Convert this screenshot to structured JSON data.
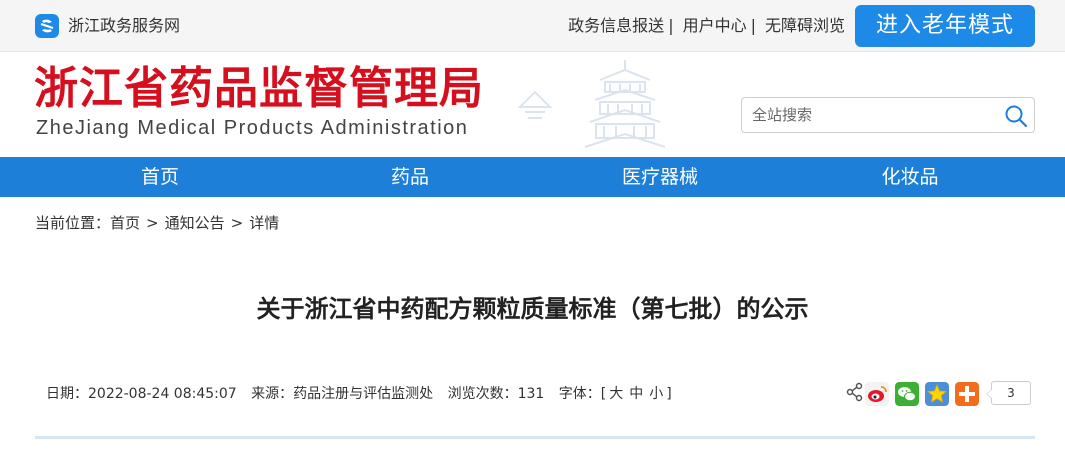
{
  "topbar": {
    "site_name": "浙江政务服务网",
    "links": [
      {
        "label": "政务信息报送"
      },
      {
        "label": "用户中心"
      },
      {
        "label": "无障碍浏览"
      }
    ],
    "elder_mode_label": "进入老年模式"
  },
  "header": {
    "title_cn": "浙江省药品监督管理局",
    "title_en": "ZheJiang Medical Products Administration",
    "search_placeholder": "全站搜索"
  },
  "nav": {
    "items": [
      {
        "label": "首页"
      },
      {
        "label": "药品"
      },
      {
        "label": "医疗器械"
      },
      {
        "label": "化妆品"
      }
    ]
  },
  "breadcrumb": {
    "prefix": "当前位置：",
    "items": [
      {
        "label": "首页"
      },
      {
        "label": "通知公告"
      },
      {
        "label": "详情"
      }
    ]
  },
  "article": {
    "title": "关于浙江省中药配方颗粒质量标准（第七批）的公示",
    "meta": {
      "date": "日期：2022-08-24 08:45:07",
      "source": "来源：药品注册与评估监测处",
      "views_label": "浏览次数：",
      "views": "131",
      "font_label": "字体：[",
      "font_large": "大",
      "font_medium": "中",
      "font_small": "小",
      "font_close": "]"
    }
  },
  "share": {
    "icons": [
      "share-icon",
      "weibo-icon",
      "wechat-icon",
      "favorite-star-icon",
      "more-plus-icon"
    ],
    "count": "3"
  },
  "colors": {
    "brand_blue": "#1e7fd8",
    "title_red": "#d60f1e",
    "topbar_bg": "#f5f5f5"
  }
}
